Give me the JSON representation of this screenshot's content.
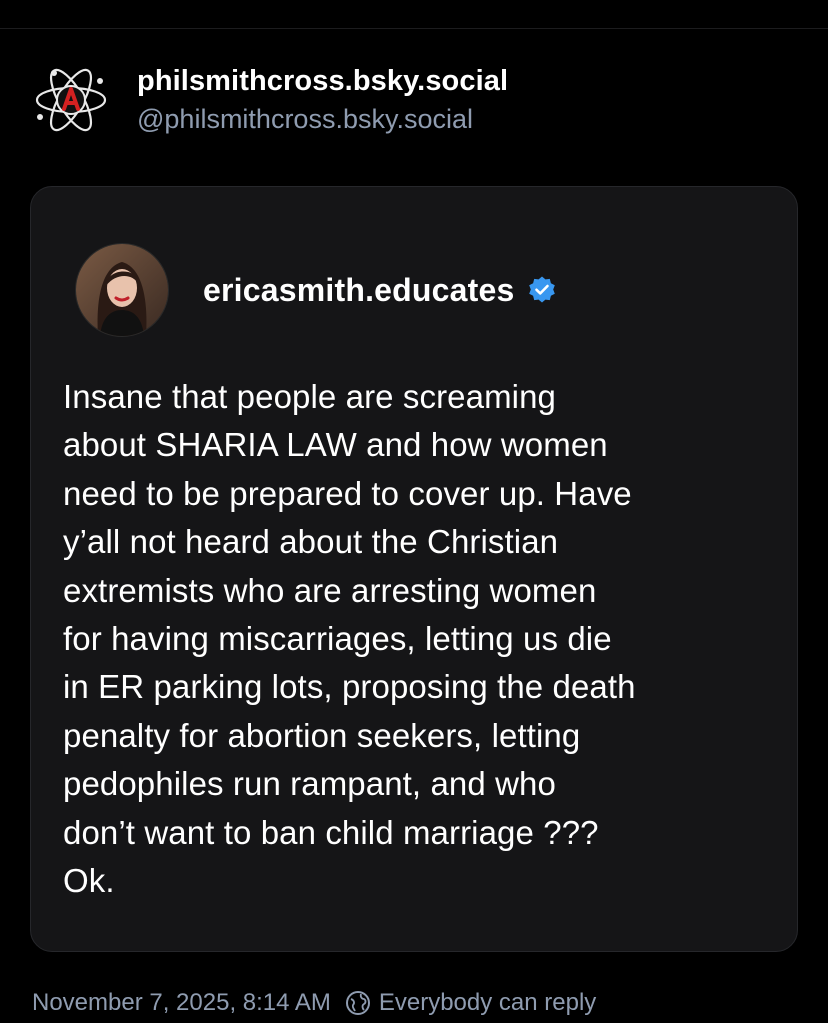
{
  "post": {
    "author": {
      "display_name": "philsmithcross.bsky.social",
      "handle": "@philsmithcross.bsky.social",
      "avatar_icon": "anarchy-atom-logo-icon"
    },
    "quoted_post": {
      "author_name": "ericasmith.educates",
      "avatar": "profile-photo",
      "verified_icon": "verified-badge-icon",
      "verified_color": "#3897f0",
      "text": "Insane that people are screaming\nabout SHARIA LAW and how women\nneed to be prepared to cover up. Have\ny’all not heard about the Christian\nextremists who are arresting women\nfor having miscarriages, letting us die\nin ER parking lots, proposing the death\npenalty for abortion seekers, letting\npedophiles run rampant, and who\ndon’t want to ban child marriage ???\nOk."
    },
    "footer": {
      "timestamp": "November 7, 2025, 8:14 AM",
      "reply_icon": "globe-reply-icon",
      "reply_setting": "Everybody can reply"
    }
  },
  "colors": {
    "background": "#000000",
    "card_background": "#151517",
    "card_border": "#26272b",
    "secondary_text": "#8f9cb0",
    "primary_text": "#ffffff"
  }
}
